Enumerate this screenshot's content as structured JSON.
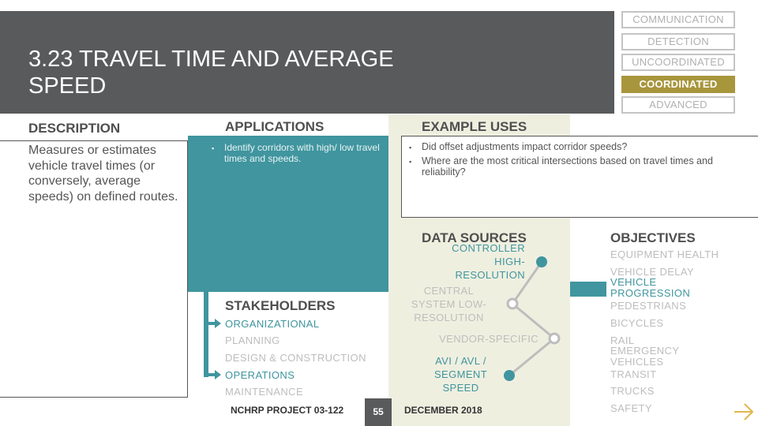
{
  "header": {
    "title": "3.23 TRAVEL TIME AND AVERAGE SPEED"
  },
  "tiers": [
    {
      "label": "COMMUNICATION",
      "active": false
    },
    {
      "label": "DETECTION",
      "active": false
    },
    {
      "label": "UNCOORDINATED",
      "active": false
    },
    {
      "label": "COORDINATED",
      "active": true
    },
    {
      "label": "ADVANCED",
      "active": false
    }
  ],
  "description": {
    "heading": "DESCRIPTION",
    "text": "Measures or estimates vehicle travel times (or conversely, average speeds) on defined routes."
  },
  "applications": {
    "heading": "APPLICATIONS",
    "items": [
      "Identify corridors with high/ low travel times and speeds."
    ]
  },
  "example_uses": {
    "heading": "EXAMPLE USES",
    "items": [
      "Did offset adjustments impact corridor speeds?",
      "Where are the most critical intersections based on travel times and reliability?"
    ]
  },
  "stakeholders": {
    "heading": "STAKEHOLDERS",
    "items": [
      {
        "label": "ORGANIZATIONAL",
        "highlighted": true
      },
      {
        "label": "PLANNING",
        "highlighted": false
      },
      {
        "label": "DESIGN & CONSTRUCTION",
        "highlighted": false
      },
      {
        "label": "OPERATIONS",
        "highlighted": true
      },
      {
        "label": "MAINTENANCE",
        "highlighted": false
      }
    ]
  },
  "data_sources": {
    "heading": "DATA SOURCES",
    "items": [
      {
        "label": "CONTROLLER HIGH-RESOLUTION",
        "lines": [
          "CONTROLLER",
          "HIGH-",
          "RESOLUTION"
        ],
        "highlighted": true
      },
      {
        "label": "CENTRAL SYSTEM LOW-RESOLUTION",
        "lines": [
          "CENTRAL",
          "SYSTEM LOW-",
          "RESOLUTION"
        ],
        "highlighted": false
      },
      {
        "label": "VENDOR-SPECIFIC",
        "lines": [
          "VENDOR-SPECIFIC"
        ],
        "highlighted": false
      },
      {
        "label": "AVI / AVL / SEGMENT SPEED",
        "lines": [
          "AVI / AVL /",
          "SEGMENT",
          "SPEED"
        ],
        "highlighted": true
      }
    ]
  },
  "objectives": {
    "heading": "OBJECTIVES",
    "items": [
      {
        "label": "EQUIPMENT HEALTH",
        "highlighted": false
      },
      {
        "label": "VEHICLE DELAY",
        "highlighted": false
      },
      {
        "label": "VEHICLE PROGRESSION",
        "highlighted": true
      },
      {
        "label": "PEDESTRIANS",
        "highlighted": false
      },
      {
        "label": "BICYCLES",
        "highlighted": false
      },
      {
        "label": "RAIL",
        "highlighted": false
      },
      {
        "label": "EMERGENCY VEHICLES",
        "highlighted": false
      },
      {
        "label": "TRANSIT",
        "highlighted": false
      },
      {
        "label": "TRUCKS",
        "highlighted": false
      },
      {
        "label": "SAFETY",
        "highlighted": false
      }
    ]
  },
  "footer": {
    "project": "NCHRP PROJECT 03-122",
    "page_number": "55",
    "date": "DECEMBER 2018"
  },
  "colors": {
    "teal": "#40959f",
    "gold": "#a8963d",
    "header_gray": "#595a5c",
    "cream": "#efefe0",
    "muted": "#bdbdbd",
    "arrow": "#e0b84a"
  }
}
